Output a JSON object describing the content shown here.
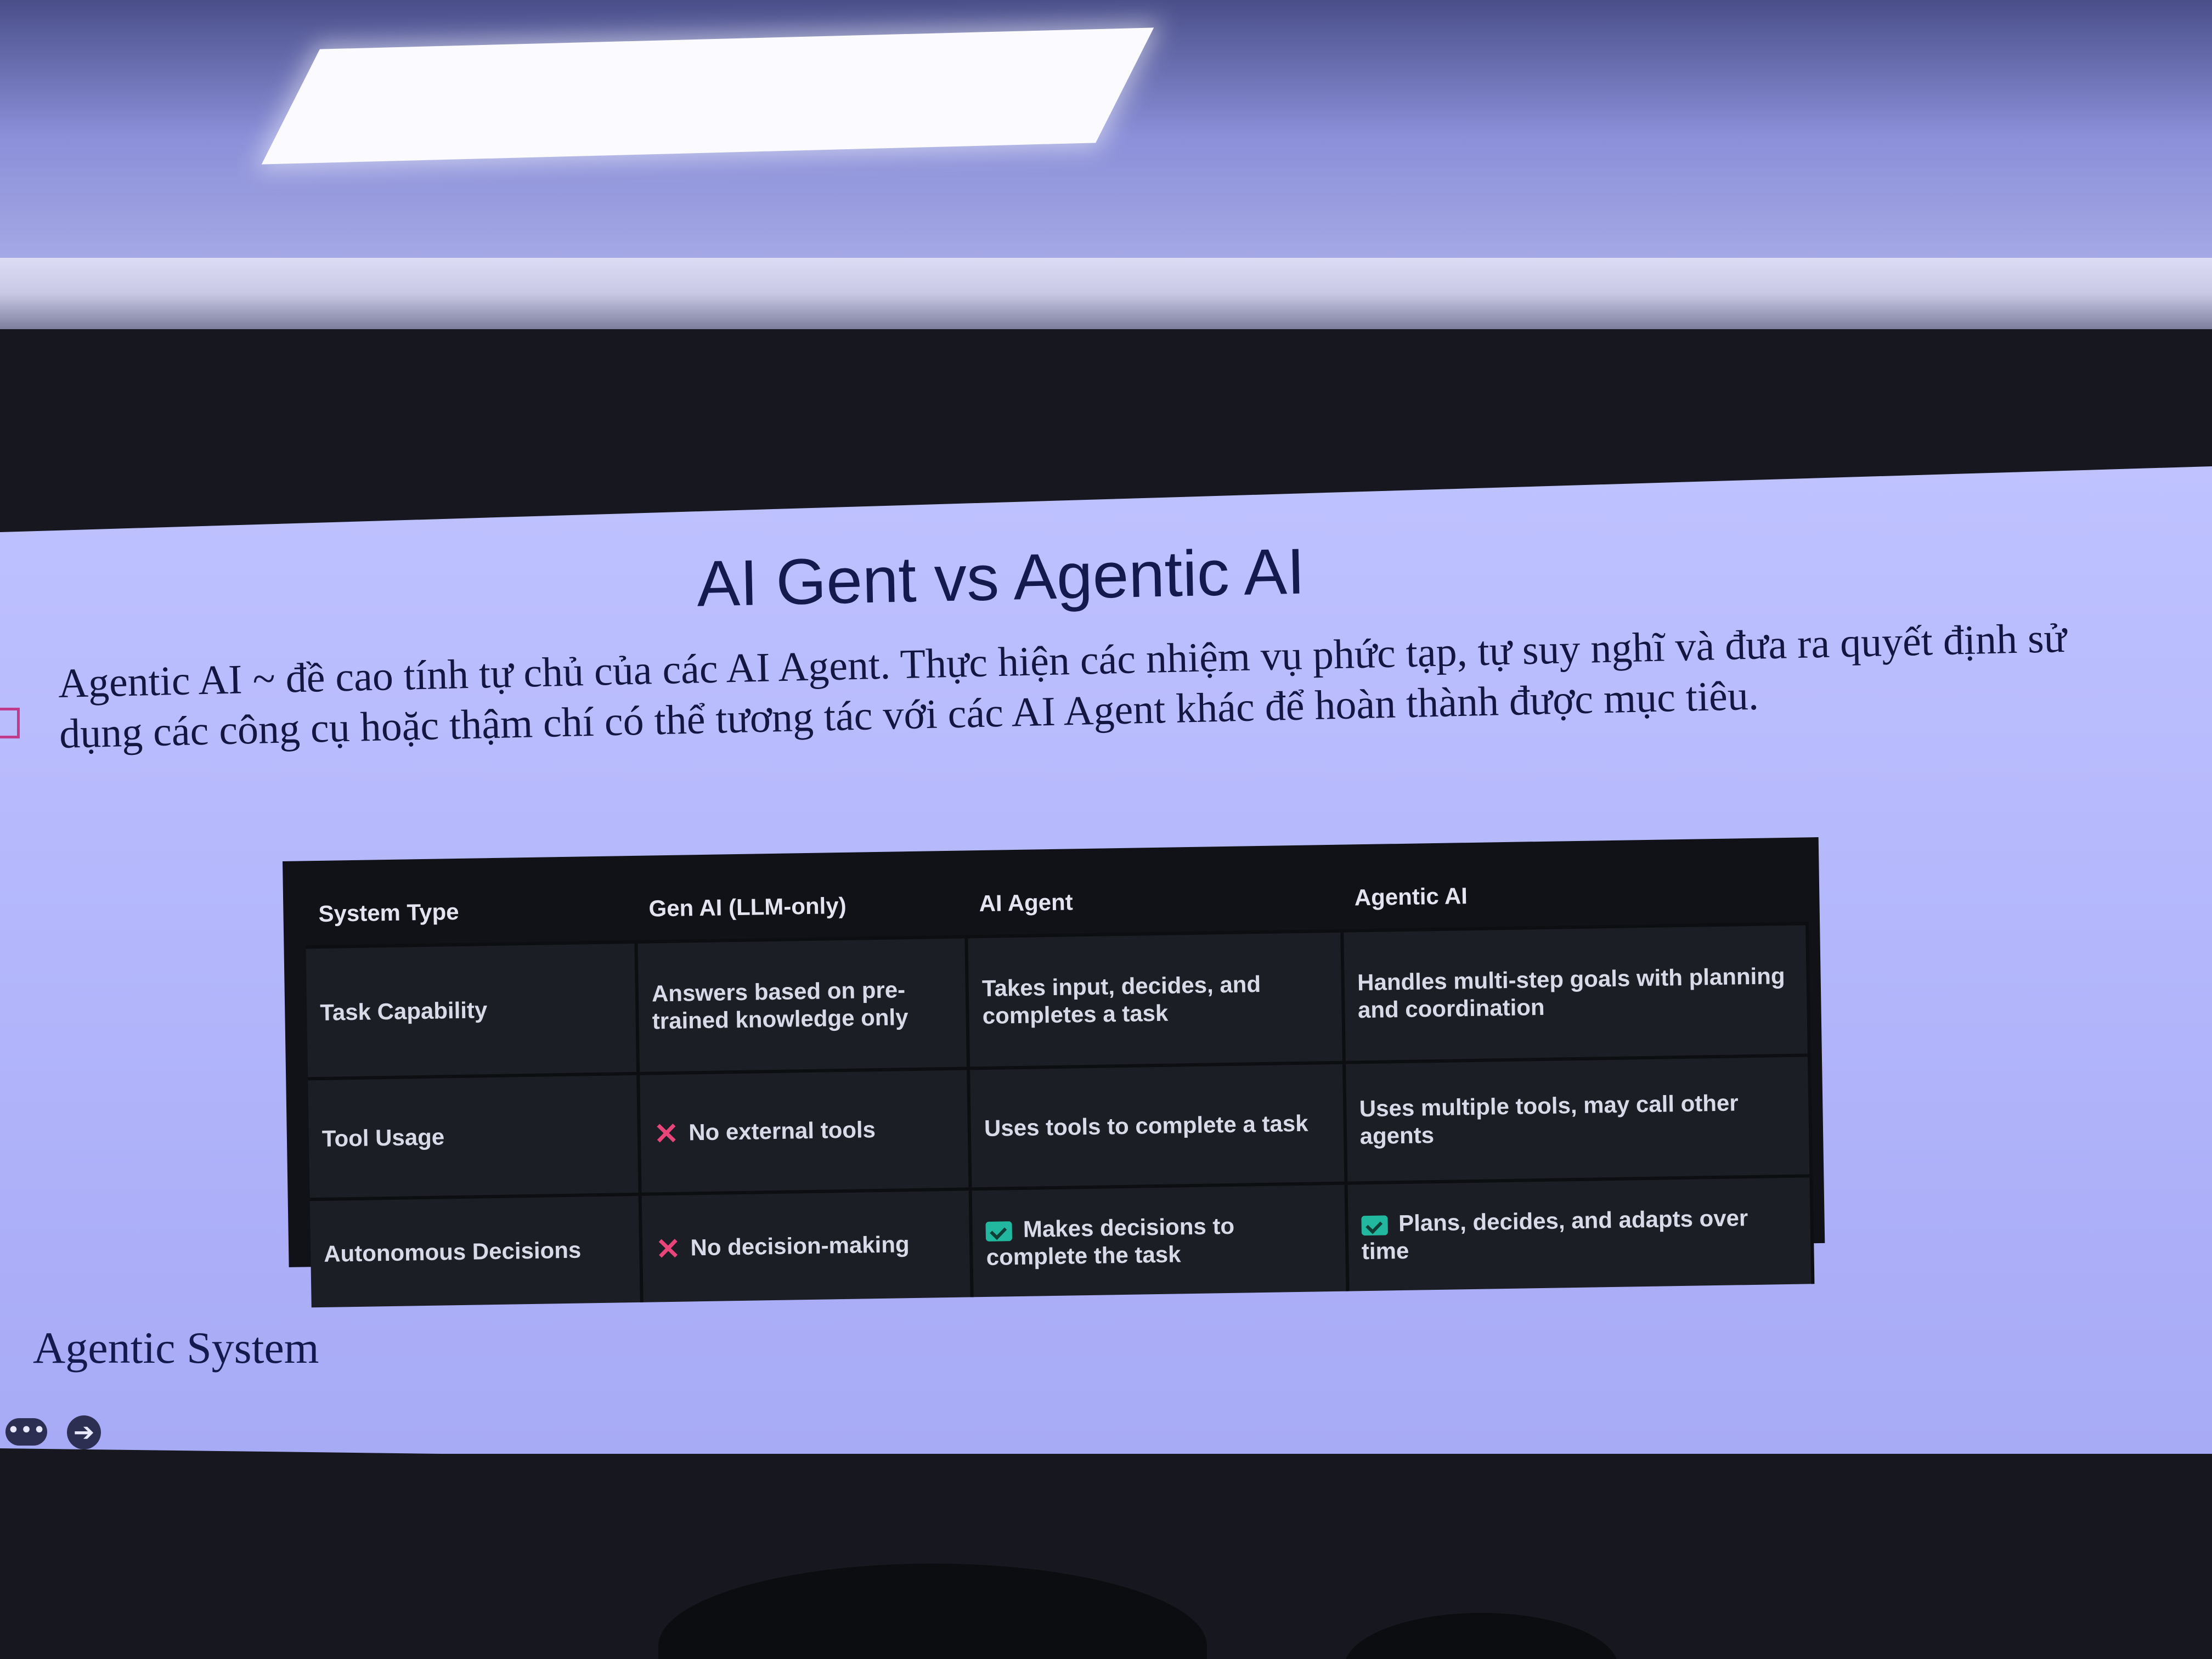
{
  "slide": {
    "title": "AI Gent vs Agentic AI",
    "body": "Agentic AI ~ đề cao tính tự chủ của các AI Agent. Thực hiện các nhiệm vụ phức tạp, tự suy nghĩ và đưa ra quyết định sử dụng các công cụ hoặc thậm chí có thể tương tác với các AI Agent khác để hoàn thành được mục tiêu.",
    "footer_label": "Agentic System",
    "nav_more_glyph": "•••",
    "nav_next_glyph": "➔"
  },
  "table": {
    "headers": [
      "System Type",
      "Gen AI (LLM-only)",
      "AI Agent",
      "Agentic AI"
    ],
    "rows": [
      {
        "label": "Task Capability",
        "genai": "Answers based on pre-trained knowledge only",
        "agent": "Takes input, decides, and completes a task",
        "agentic": "Handles multi-step goals with planning and coordination"
      },
      {
        "label": "Tool Usage",
        "genai": "No external tools",
        "genai_icon": "cross-icon",
        "agent": "Uses tools to complete a task",
        "agentic": "Uses multiple tools, may call other agents"
      },
      {
        "label": "Autonomous Decisions",
        "genai": "No decision-making",
        "genai_icon": "cross-icon",
        "agent": "Makes decisions to complete the task",
        "agent_icon": "check-icon",
        "agentic": "Plans, decides, and adapts over time",
        "agentic_icon": "check-icon"
      }
    ],
    "cross_glyph": "✕"
  },
  "colors": {
    "slide_bg": "#b3b6fb",
    "title": "#141a4d",
    "table_bg": "#111217",
    "cross": "#e8457a",
    "check": "#22b8a0"
  }
}
